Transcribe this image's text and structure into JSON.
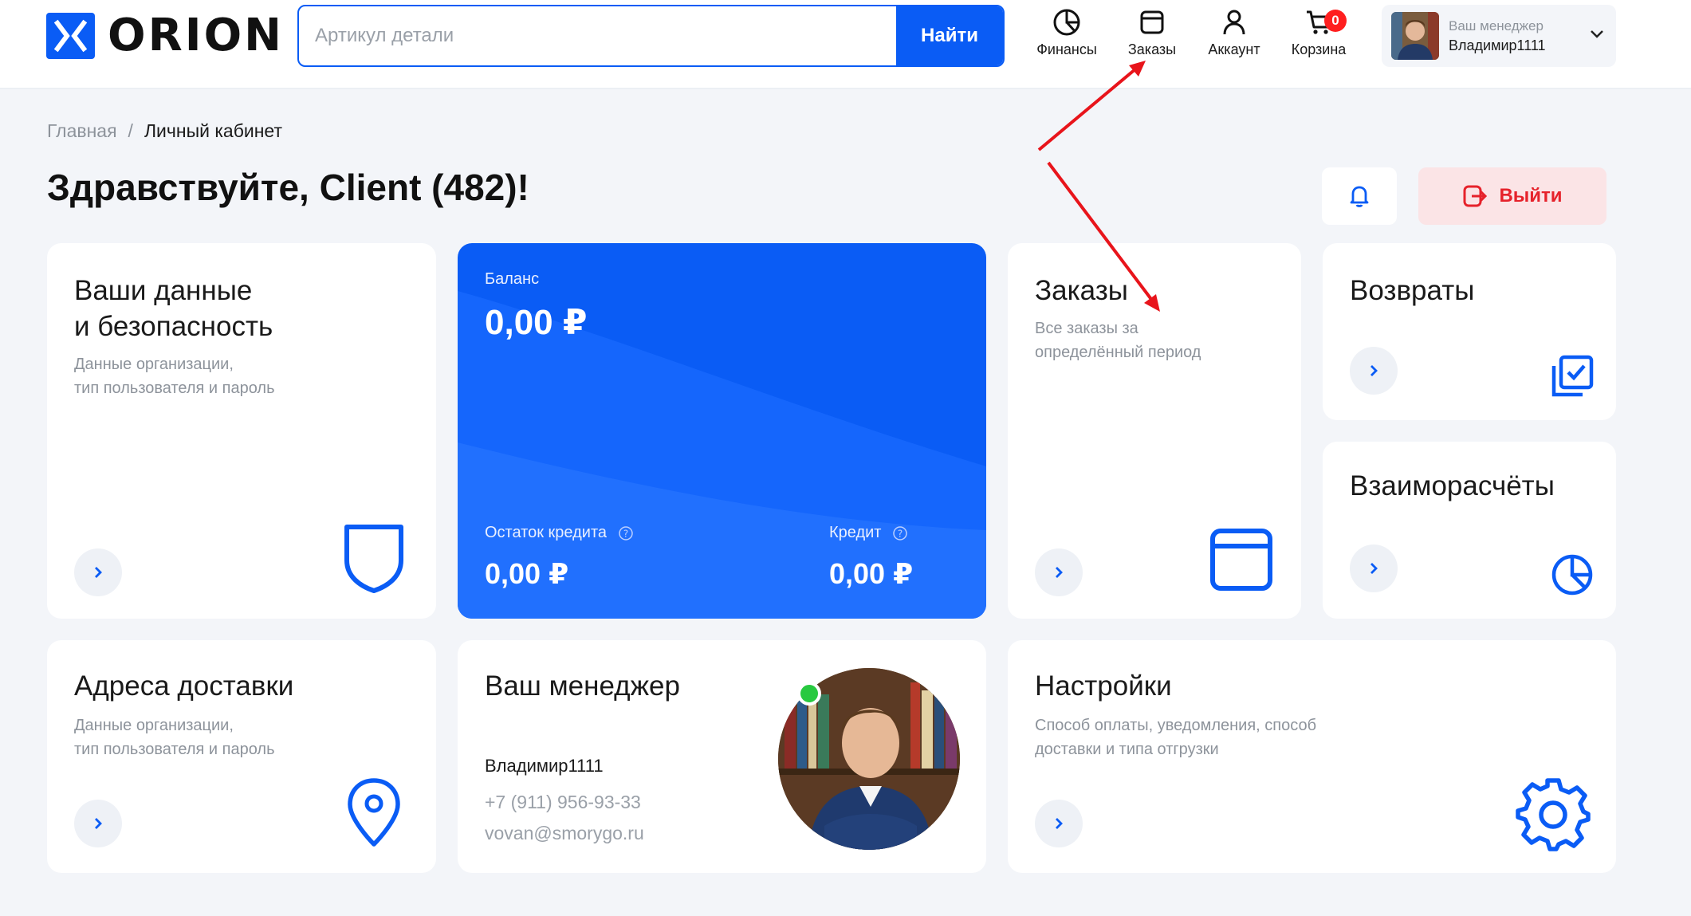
{
  "brand": {
    "logo_text": "ORION",
    "accent": "#0a5cf5",
    "danger": "#e6222b"
  },
  "search": {
    "placeholder": "Артикул детали",
    "button_label": "Найти"
  },
  "nav": {
    "finance": {
      "label": "Финансы",
      "icon": "pie-chart-icon"
    },
    "orders": {
      "label": "Заказы",
      "icon": "box-icon"
    },
    "account": {
      "label": "Аккаунт",
      "icon": "user-icon"
    },
    "cart": {
      "label": "Корзина",
      "icon": "cart-icon",
      "count": "0"
    }
  },
  "manager_pill": {
    "caption": "Ваш менеджер",
    "name": "Владимир1111"
  },
  "breadcrumb": {
    "home": "Главная",
    "separator": "/",
    "current": "Личный кабинет"
  },
  "page_title": "Здравствуйте, Client (482)!",
  "actions": {
    "logout_label": "Выйти"
  },
  "cards": {
    "security": {
      "title_line1": "Ваши данные",
      "title_line2": "и безопасность",
      "desc_line1": "Данные организации,",
      "desc_line2": "тип пользователя и пароль"
    },
    "balance": {
      "balance_label": "Баланс",
      "balance_value": "0,00 ₽",
      "credit_rest_label": "Остаток кредита",
      "credit_rest_value": "0,00 ₽",
      "credit_label": "Кредит",
      "credit_value": "0,00 ₽"
    },
    "orders": {
      "title": "Заказы",
      "desc_line1": "Все заказы за",
      "desc_line2": "определённый период"
    },
    "returns": {
      "title": "Возвраты"
    },
    "settlements": {
      "title": "Взаиморасчёты"
    },
    "addresses": {
      "title": "Адреса доставки",
      "desc_line1": "Данные организации,",
      "desc_line2": "тип пользователя и пароль"
    },
    "manager": {
      "title": "Ваш менеджер",
      "name": "Владимир1111",
      "phone": "+7 (911) 956-93-33",
      "email": "vovan@smorygo.ru",
      "status": "online"
    },
    "settings": {
      "title": "Настройки",
      "desc_line1": "Способ оплаты, уведомления, способ",
      "desc_line2": "доставки и типа отгрузки"
    }
  }
}
